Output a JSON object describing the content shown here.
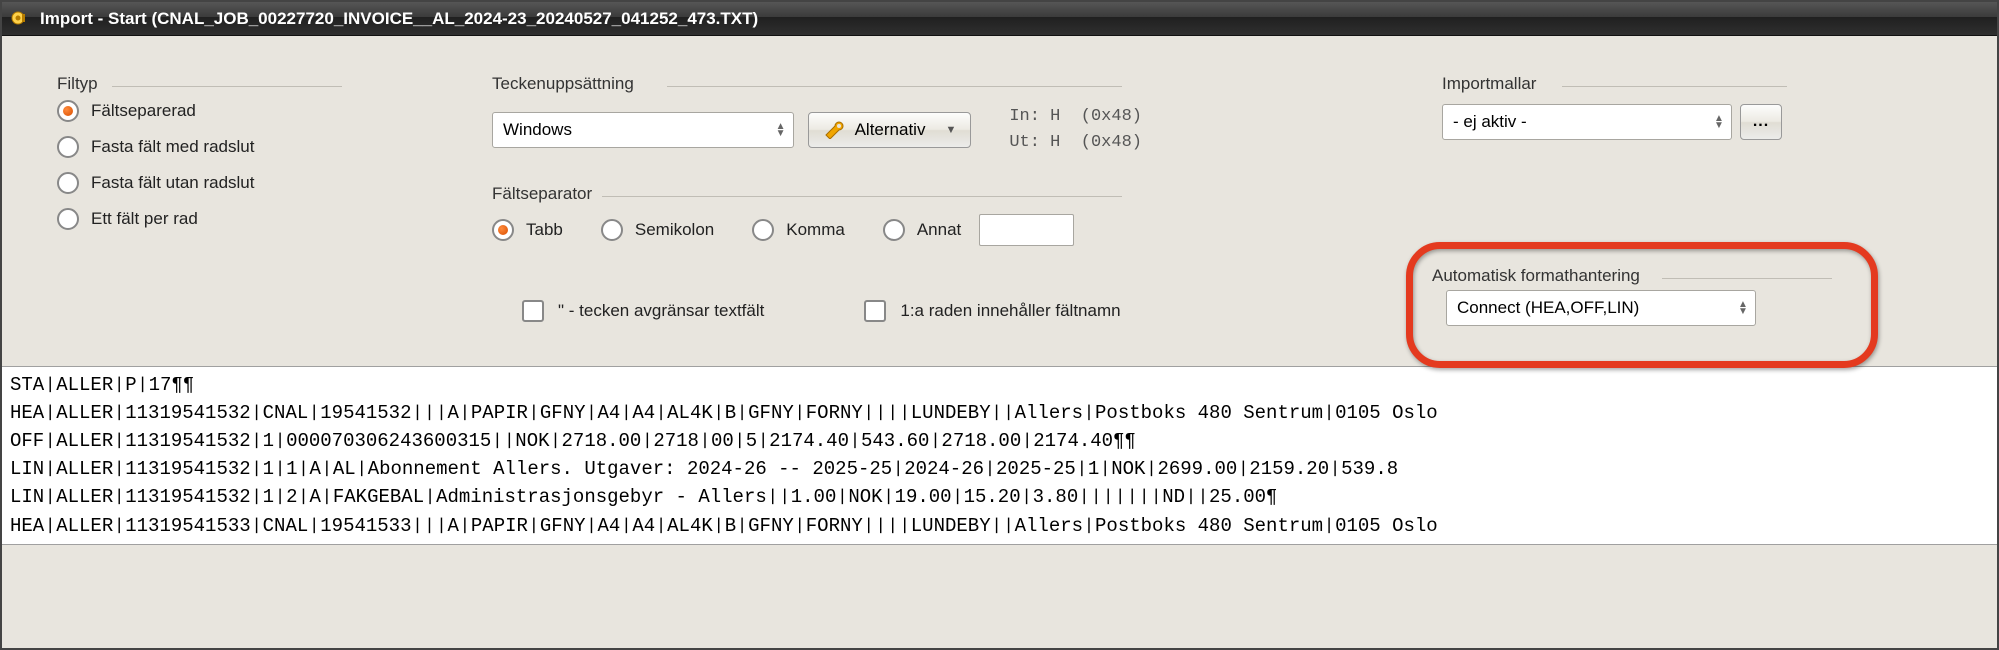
{
  "titlebar": {
    "title": "Import - Start  (CNAL_JOB_00227720_INVOICE__AL_2024-23_20240527_041252_473.TXT)"
  },
  "filtyp": {
    "legend": "Filtyp",
    "options": [
      {
        "id": "faltseparerad",
        "label": "Fältseparerad",
        "selected": true
      },
      {
        "id": "fasta-radslut",
        "label": "Fasta fält med radslut",
        "selected": false
      },
      {
        "id": "fasta-utan",
        "label": "Fasta fält utan radslut",
        "selected": false
      },
      {
        "id": "ett-falt",
        "label": "Ett fält per rad",
        "selected": false
      }
    ]
  },
  "charset": {
    "legend": "Teckenuppsättning",
    "encoding_value": "Windows",
    "alternativ_label": "Alternativ",
    "in_label": "In:",
    "ut_label": "Ut:",
    "in_value": "H  (0x48)",
    "ut_value": "H  (0x48)"
  },
  "faltseparator": {
    "legend": "Fältseparator",
    "options": [
      {
        "id": "tabb",
        "label": "Tabb",
        "selected": true
      },
      {
        "id": "semikolon",
        "label": "Semikolon",
        "selected": false
      },
      {
        "id": "komma",
        "label": "Komma",
        "selected": false
      },
      {
        "id": "annat",
        "label": "Annat",
        "selected": false
      }
    ],
    "annat_value": ""
  },
  "checkboxes": {
    "quote_delim": {
      "label": "\" - tecken avgränsar textfält",
      "checked": false
    },
    "first_row_names": {
      "label": "1:a raden innehåller fältnamn",
      "checked": false
    }
  },
  "importmallar": {
    "legend": "Importmallar",
    "value": "- ej aktiv -",
    "browse_label": "..."
  },
  "autoformat": {
    "legend": "Automatisk formathantering",
    "value": "Connect (HEA,OFF,LIN)"
  },
  "preview": {
    "sep_glyph": "❘",
    "pilcrow": "¶",
    "lines": [
      [
        "STA",
        "ALLER",
        "P",
        "17",
        "¶¶"
      ],
      [
        "HEA",
        "ALLER",
        "11319541532",
        "CNAL",
        "19541532",
        "",
        "",
        "A",
        "PAPIR",
        "GFNY",
        "A4",
        "A4",
        "AL4K",
        "B",
        "GFNY",
        "FORNY",
        "",
        "",
        "",
        "LUNDEBY",
        "",
        "Allers",
        "Postboks 480 Sentrum",
        "0105 Oslo"
      ],
      [
        "OFF",
        "ALLER",
        "11319541532",
        "1",
        "000070306243600315",
        "",
        "NOK",
        "2718.00",
        "2718",
        "00",
        "5",
        "2174.40",
        "543.60",
        "2718.00",
        "2174.40",
        "¶¶"
      ],
      [
        "LIN",
        "ALLER",
        "11319541532",
        "1",
        "1",
        "A",
        "AL",
        "Abonnement Allers. Utgaver: 2024-26 -- 2025-25",
        "2024-26",
        "2025-25",
        "1",
        "NOK",
        "2699.00",
        "2159.20",
        "539.8"
      ],
      [
        "LIN",
        "ALLER",
        "11319541532",
        "1",
        "2",
        "A",
        "FAKGEBAL",
        "Administrasjonsgebyr - Allers",
        "",
        "1.00",
        "NOK",
        "19.00",
        "15.20",
        "3.80",
        "",
        "",
        "",
        "",
        "",
        "",
        "ND",
        "",
        "25.00",
        "¶"
      ],
      [
        "HEA",
        "ALLER",
        "11319541533",
        "CNAL",
        "19541533",
        "",
        "",
        "A",
        "PAPIR",
        "GFNY",
        "A4",
        "A4",
        "AL4K",
        "B",
        "GFNY",
        "FORNY",
        "",
        "",
        "",
        "LUNDEBY",
        "",
        "Allers",
        "Postboks 480 Sentrum",
        "0105 Oslo"
      ]
    ]
  }
}
